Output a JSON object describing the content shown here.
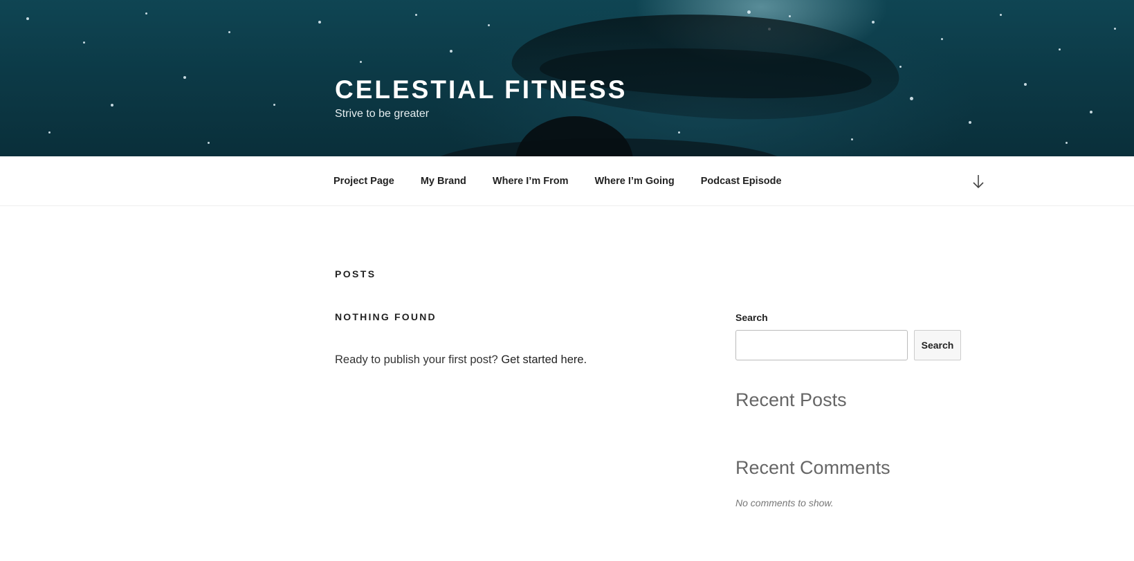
{
  "header": {
    "site_title": "CELESTIAL FITNESS",
    "tagline": "Strive to be greater"
  },
  "nav": {
    "items": [
      {
        "label": "Project Page"
      },
      {
        "label": "My Brand"
      },
      {
        "label": "Where I’m From"
      },
      {
        "label": "Where I’m Going"
      },
      {
        "label": "Podcast Episode"
      }
    ],
    "scroll_icon": "arrow-down-icon"
  },
  "main": {
    "page_title": "POSTS",
    "section_heading": "NOTHING FOUND",
    "message": "Ready to publish your first post?",
    "link_text": "Get started here."
  },
  "sidebar": {
    "search_label": "Search",
    "search_value": "",
    "search_button": "Search",
    "recent_posts_heading": "Recent Posts",
    "recent_comments_heading": "Recent Comments",
    "no_comments": "No comments to show."
  },
  "colors": {
    "header_bg": "#0c3a47",
    "text": "#222222",
    "widget_heading": "#666666"
  }
}
